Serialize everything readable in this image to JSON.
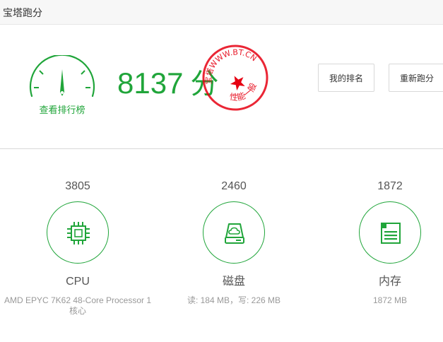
{
  "window": {
    "title": "宝塔跑分"
  },
  "summary": {
    "gauge_label": "查看排行榜",
    "score": "8137",
    "score_unit": "分"
  },
  "stamp": {
    "top_text": "宝塔WWW.BT.CN",
    "bottom_text": "性能一般",
    "color": "#e60012"
  },
  "actions": {
    "rank_label": "我的排名",
    "rerun_label": "重新跑分"
  },
  "metrics": {
    "cpu": {
      "score": "3805",
      "name": "CPU",
      "detail_line1": "AMD EPYC 7K62 48-Core Processor 1",
      "detail_line2": "核心",
      "icon": "cpu-chip-icon"
    },
    "disk": {
      "score": "2460",
      "name": "磁盘",
      "detail": "读: 184 MB，写: 226 MB",
      "icon": "cloud-disk-icon"
    },
    "mem": {
      "score": "1872",
      "name": "内存",
      "detail": "1872 MB",
      "icon": "memory-card-icon"
    }
  },
  "colors": {
    "accent": "#20a53a",
    "stamp": "#e60012",
    "muted": "#999999"
  }
}
